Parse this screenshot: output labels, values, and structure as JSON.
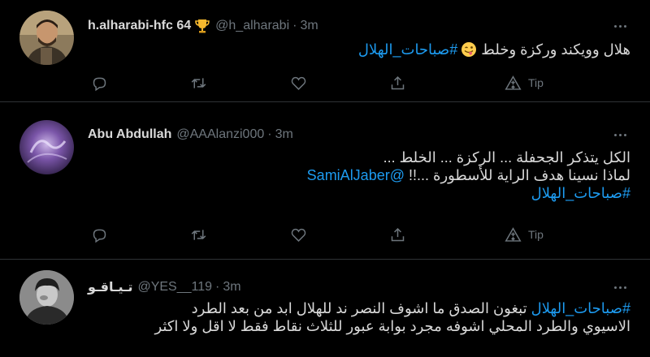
{
  "colors": {
    "background": "#000000",
    "text": "#d9d9d9",
    "muted": "#6e767d",
    "link": "#1d9bf0",
    "divider": "#2f3336"
  },
  "tweets": [
    {
      "display_name": "h.alharabi-hfc 64",
      "name_icon": "trophy-icon",
      "handle": "@h_alharabi",
      "separator": "·",
      "time": "3m",
      "lines": [
        {
          "segments": [
            {
              "type": "text",
              "text": "هلال وويكند وركزة وخلط "
            },
            {
              "type": "emoji",
              "icon": "winking-tongue-emoji-icon"
            },
            {
              "type": "hashtag",
              "text": "#صباحات_الهلال"
            }
          ]
        }
      ],
      "tip_label": "Tip"
    },
    {
      "display_name": "Abu Abdullah",
      "handle": "@AAAlanzi000",
      "separator": "·",
      "time": "3m",
      "lines": [
        {
          "segments": [
            {
              "type": "text",
              "text": "الكل يتذكر الجحفلة ... الركزة ... الخلط ..."
            }
          ]
        },
        {
          "segments": [
            {
              "type": "text",
              "text": "لماذا نسينا هدف الراية للأسطورة ...!! "
            },
            {
              "type": "mention",
              "text": "@SamiAlJaber"
            }
          ]
        },
        {
          "segments": [
            {
              "type": "hashtag",
              "text": "#صباحات_الهلال"
            }
          ]
        }
      ],
      "tip_label": "Tip"
    },
    {
      "display_name": "تـيـاقـو",
      "handle": "@YES__119",
      "separator": "·",
      "time": "3m",
      "lines": [
        {
          "segments": [
            {
              "type": "hashtag",
              "text": "#صباحات_الهلال"
            },
            {
              "type": "text",
              "text": " تبغون الصدق ما اشوف النصر ند للهلال ابد من بعد الطرد"
            }
          ]
        },
        {
          "segments": [
            {
              "type": "text",
              "text": "الاسيوي والطرد المحلي  اشوفه مجرد بوابة عبور للثلاث نقاط فقط لا اقل ولا اكثر"
            }
          ]
        }
      ]
    }
  ],
  "action_icons": [
    "reply-icon",
    "retweet-icon",
    "like-icon",
    "share-icon",
    "tip-icon"
  ]
}
